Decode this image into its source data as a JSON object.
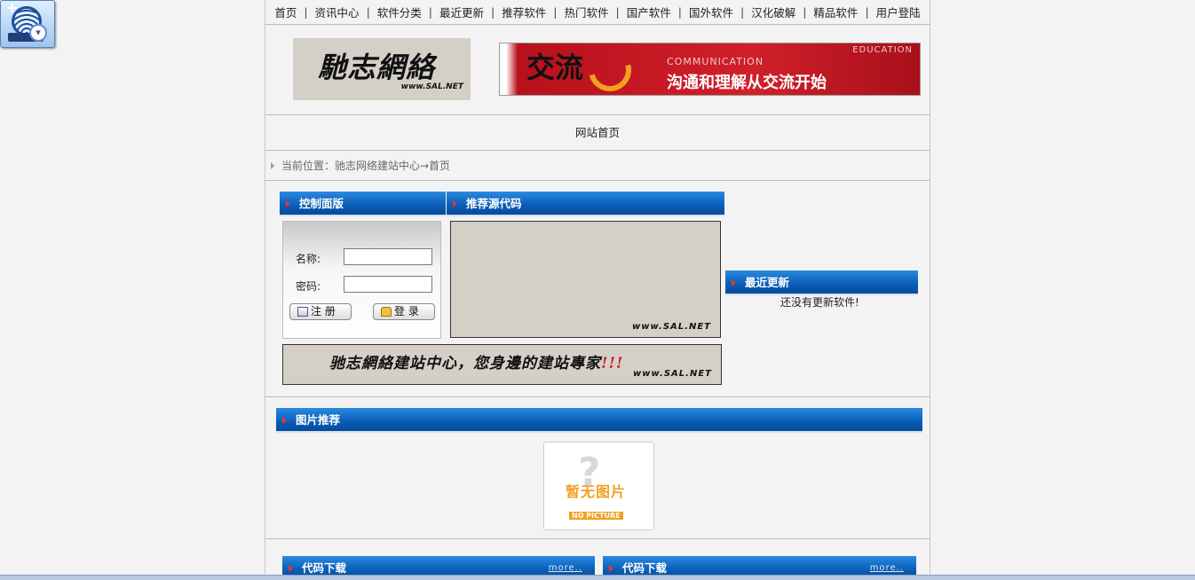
{
  "nav": {
    "items": [
      "首页",
      "资讯中心",
      "软件分类",
      "最近更新",
      "推荐软件",
      "热门软件",
      "国产软件",
      "国外软件",
      "汉化破解",
      "精品软件",
      "用户登陆"
    ]
  },
  "logo": {
    "name": "馳志網絡",
    "url": "www.SAL.NET"
  },
  "banner": {
    "glyph": "交流",
    "education": "EDUCATION",
    "english": "COMMUNICATION",
    "slogan": "沟通和理解从交流开始"
  },
  "home_link": "网站首页",
  "breadcrumb": "当前位置：驰志网络建站中心→首页",
  "panels": {
    "control": "控制面版",
    "source": "推荐源代码",
    "latest": "最近更新",
    "pictures": "图片推荐",
    "code_left": "代码下载",
    "code_right": "代码下载",
    "more": "more.."
  },
  "login": {
    "name_label": "名称:",
    "password_label": "密码:",
    "name_value": "",
    "password_value": "",
    "register_button": "注 册",
    "login_button": "登 录"
  },
  "code_box_url": "www.SAL.NET",
  "slogan_box": {
    "text": "驰志網絡建站中心，您身邊的建站專家",
    "exclaim": "!!!",
    "url": "www.SAL.NET"
  },
  "latest_empty": "还没有更新软件!",
  "no_picture": {
    "cn": "暂无图片",
    "en": "NO PICTURE"
  },
  "colors": {
    "bar_blue": "#0a5db6",
    "banner_red": "#d0202a",
    "accent_orange": "#f0a020"
  }
}
